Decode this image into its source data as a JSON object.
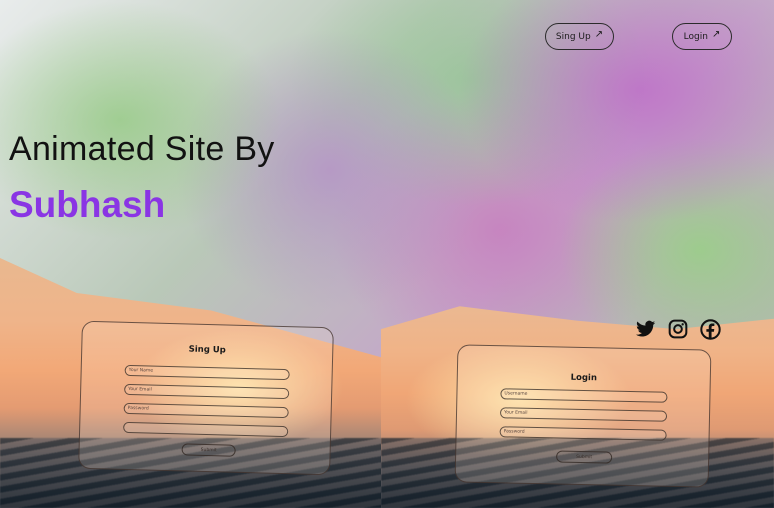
{
  "nav": {
    "signup_label": "Sing Up",
    "login_label": "Login",
    "arrow_glyph": "↗"
  },
  "hero": {
    "line1": "Animated Site By",
    "line2": "Subhash",
    "accent_color": "#8a35e4"
  },
  "signup_form": {
    "title": "Sing Up",
    "fields": [
      "Your Name",
      "Your Email",
      "Password",
      ""
    ],
    "submit_label": "Submit"
  },
  "login_form": {
    "title": "Login",
    "fields": [
      "Username",
      "Your Email",
      "Password"
    ],
    "submit_label": "Submit"
  },
  "social_icons": [
    "twitter-icon",
    "instagram-icon",
    "facebook-icon"
  ]
}
